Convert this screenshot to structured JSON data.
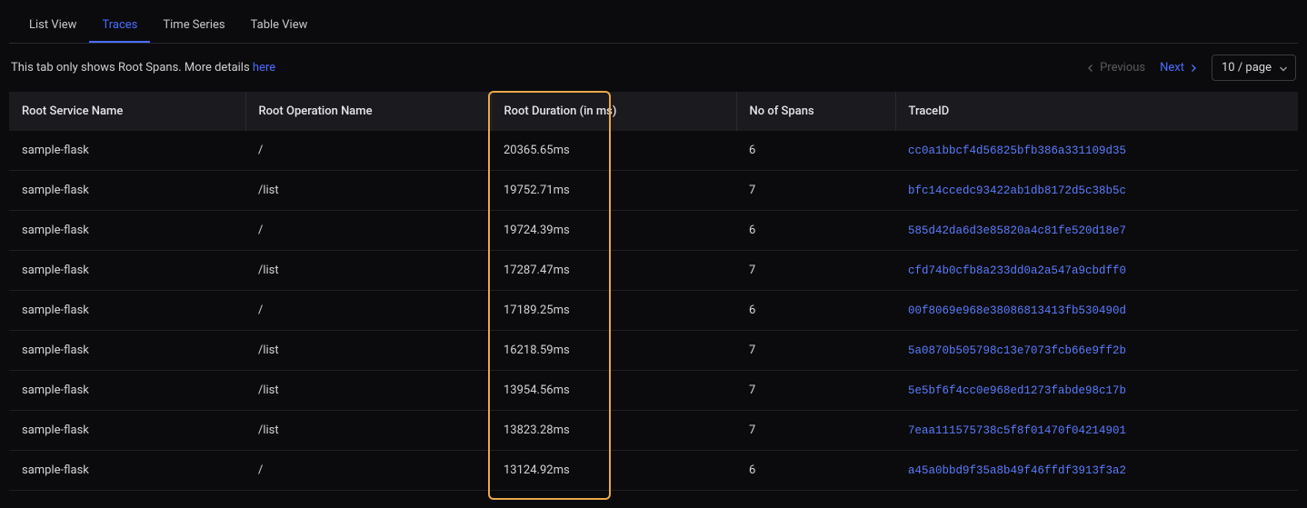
{
  "tabs": {
    "items": [
      {
        "label": "List View"
      },
      {
        "label": "Traces"
      },
      {
        "label": "Time Series"
      },
      {
        "label": "Table View"
      }
    ],
    "active_index": 1
  },
  "info": {
    "text_before": "This tab only shows Root Spans. More details ",
    "link_text": "here"
  },
  "pagination": {
    "prev_label": "Previous",
    "next_label": "Next",
    "page_size_label": "10 / page"
  },
  "table": {
    "headers": {
      "service": "Root Service Name",
      "operation": "Root Operation Name",
      "duration": "Root Duration (in ms)",
      "spans": "No of Spans",
      "traceid": "TraceID"
    },
    "rows": [
      {
        "service": "sample-flask",
        "operation": "/",
        "duration": "20365.65ms",
        "spans": "6",
        "traceid": "cc0a1bbcf4d56825bfb386a331109d35"
      },
      {
        "service": "sample-flask",
        "operation": "/list",
        "duration": "19752.71ms",
        "spans": "7",
        "traceid": "bfc14ccedc93422ab1db8172d5c38b5c"
      },
      {
        "service": "sample-flask",
        "operation": "/",
        "duration": "19724.39ms",
        "spans": "6",
        "traceid": "585d42da6d3e85820a4c81fe520d18e7"
      },
      {
        "service": "sample-flask",
        "operation": "/list",
        "duration": "17287.47ms",
        "spans": "7",
        "traceid": "cfd74b0cfb8a233dd0a2a547a9cbdff0"
      },
      {
        "service": "sample-flask",
        "operation": "/",
        "duration": "17189.25ms",
        "spans": "6",
        "traceid": "00f8069e968e38086813413fb530490d"
      },
      {
        "service": "sample-flask",
        "operation": "/list",
        "duration": "16218.59ms",
        "spans": "7",
        "traceid": "5a0870b505798c13e7073fcb66e9ff2b"
      },
      {
        "service": "sample-flask",
        "operation": "/list",
        "duration": "13954.56ms",
        "spans": "7",
        "traceid": "5e5bf6f4cc0e968ed1273fabde98c17b"
      },
      {
        "service": "sample-flask",
        "operation": "/list",
        "duration": "13823.28ms",
        "spans": "7",
        "traceid": "7eaa111575738c5f8f01470f04214901"
      },
      {
        "service": "sample-flask",
        "operation": "/",
        "duration": "13124.92ms",
        "spans": "6",
        "traceid": "a45a0bbd9f35a8b49f46ffdf3913f3a2"
      }
    ]
  }
}
